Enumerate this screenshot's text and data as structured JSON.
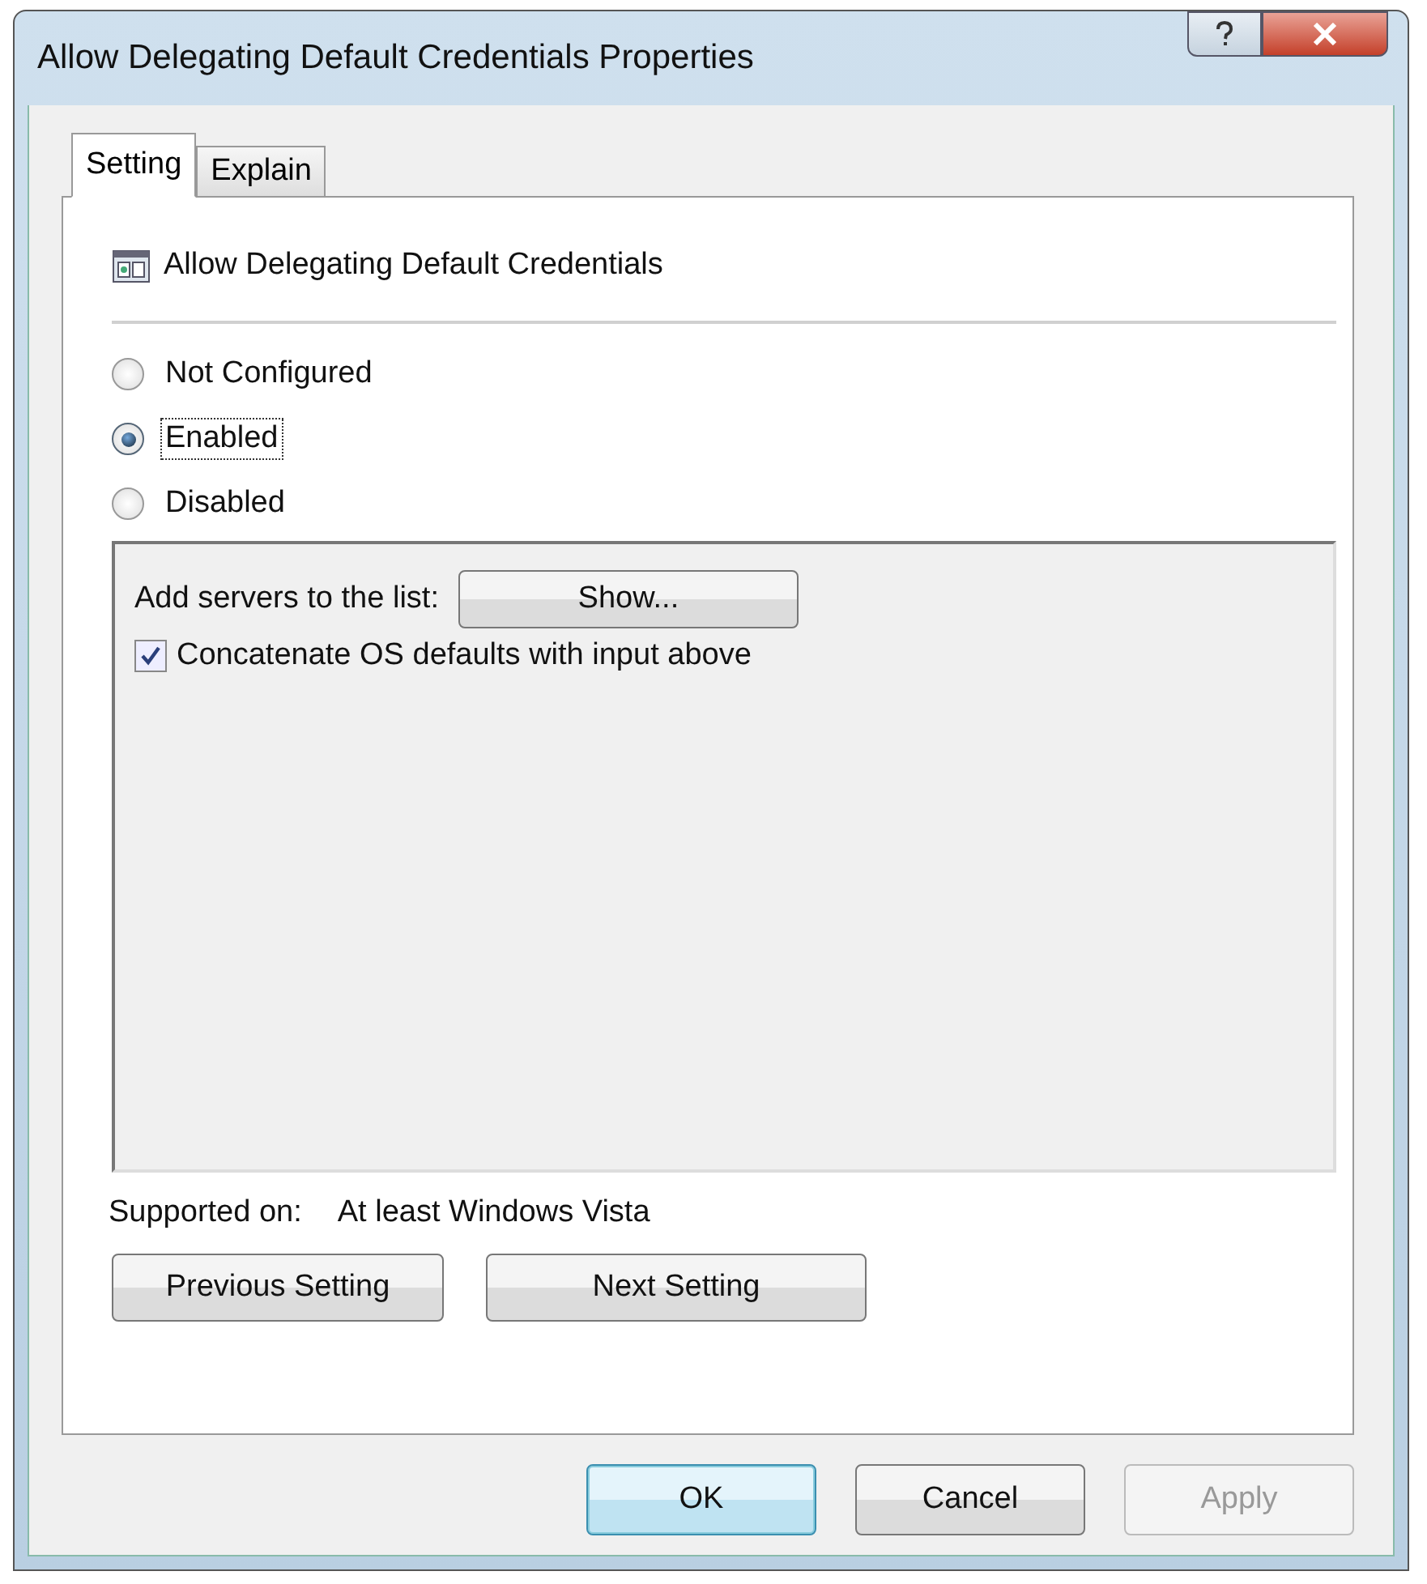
{
  "window": {
    "title": "Allow Delegating Default Credentials Properties"
  },
  "tabs": [
    {
      "label": "Setting",
      "selected": true
    },
    {
      "label": "Explain",
      "selected": false
    }
  ],
  "policy": {
    "name": "Allow Delegating Default Credentials"
  },
  "options": [
    {
      "label": "Not Configured",
      "selected": false,
      "focused": false
    },
    {
      "label": "Enabled",
      "selected": true,
      "focused": true
    },
    {
      "label": "Disabled",
      "selected": false,
      "focused": false
    }
  ],
  "options_panel": {
    "servers_label": "Add servers to the list:",
    "show_button": "Show...",
    "checkbox": {
      "label": "Concatenate OS defaults with input above",
      "checked": true
    }
  },
  "supported": {
    "label": "Supported on:",
    "value": "At least Windows Vista"
  },
  "nav_buttons": [
    "Previous Setting",
    "Next Setting"
  ],
  "buttons": [
    {
      "label": "OK",
      "default": true,
      "disabled": false
    },
    {
      "label": "Cancel",
      "default": false,
      "disabled": false
    },
    {
      "label": "Apply",
      "default": false,
      "disabled": true
    }
  ]
}
